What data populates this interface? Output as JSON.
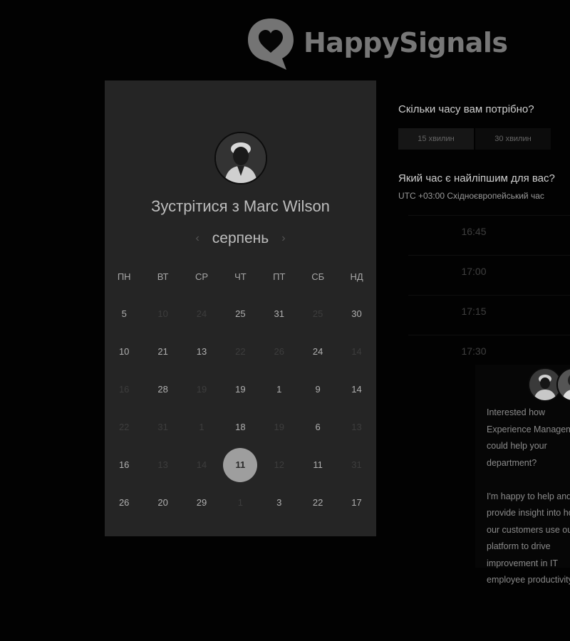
{
  "brand": {
    "name": "HappySignals",
    "logo_icon": "heart-speech-bubble-icon"
  },
  "calendar": {
    "title": "Зустрітися з Marc Wilson",
    "month": "серпень",
    "prev_icon": "chevron-left-icon",
    "next_icon": "chevron-right-icon",
    "weekdays": [
      "ПН",
      "ВТ",
      "СР",
      "ЧТ",
      "ПТ",
      "СБ",
      "НД"
    ],
    "weeks": [
      [
        {
          "d": "5",
          "on": true
        },
        {
          "d": "10",
          "on": false
        },
        {
          "d": "24",
          "on": false
        },
        {
          "d": "25",
          "on": true
        },
        {
          "d": "31",
          "on": true
        },
        {
          "d": "25",
          "on": false
        },
        {
          "d": "30",
          "on": true
        }
      ],
      [
        {
          "d": "10",
          "on": true
        },
        {
          "d": "21",
          "on": true
        },
        {
          "d": "13",
          "on": true
        },
        {
          "d": "22",
          "on": false
        },
        {
          "d": "26",
          "on": false
        },
        {
          "d": "24",
          "on": true
        },
        {
          "d": "14",
          "on": false
        }
      ],
      [
        {
          "d": "16",
          "on": false
        },
        {
          "d": "28",
          "on": true
        },
        {
          "d": "19",
          "on": false
        },
        {
          "d": "19",
          "on": true
        },
        {
          "d": "1",
          "on": true
        },
        {
          "d": "9",
          "on": true
        },
        {
          "d": "14",
          "on": true
        }
      ],
      [
        {
          "d": "22",
          "on": false
        },
        {
          "d": "31",
          "on": false
        },
        {
          "d": "1",
          "on": false
        },
        {
          "d": "18",
          "on": true
        },
        {
          "d": "19",
          "on": false
        },
        {
          "d": "6",
          "on": true
        },
        {
          "d": "13",
          "on": false
        }
      ],
      [
        {
          "d": "16",
          "on": true
        },
        {
          "d": "13",
          "on": false
        },
        {
          "d": "14",
          "on": false
        },
        {
          "d": "11",
          "on": true,
          "selected": true
        },
        {
          "d": "12",
          "on": false
        },
        {
          "d": "11",
          "on": true
        },
        {
          "d": "31",
          "on": false
        }
      ],
      [
        {
          "d": "26",
          "on": true
        },
        {
          "d": "20",
          "on": true
        },
        {
          "d": "29",
          "on": true
        },
        {
          "d": "1",
          "on": false
        },
        {
          "d": "3",
          "on": true
        },
        {
          "d": "22",
          "on": true
        },
        {
          "d": "17",
          "on": true
        }
      ]
    ]
  },
  "booking": {
    "duration_question": "Скільки часу вам потрібно?",
    "durations": [
      "15 хвилин",
      "30 хвилин"
    ],
    "time_question": "Який час є найліпшим для вас?",
    "timezone": "UTC +03:00 Східноєвропейський час",
    "slots": [
      "16:45",
      "17:00",
      "17:15",
      "17:30"
    ]
  },
  "chat": {
    "message": "Interested how Experience Management could help your department?\n\nI'm happy to help and provide insight into how our customers use our platform to drive improvement in IT employee productivity"
  }
}
